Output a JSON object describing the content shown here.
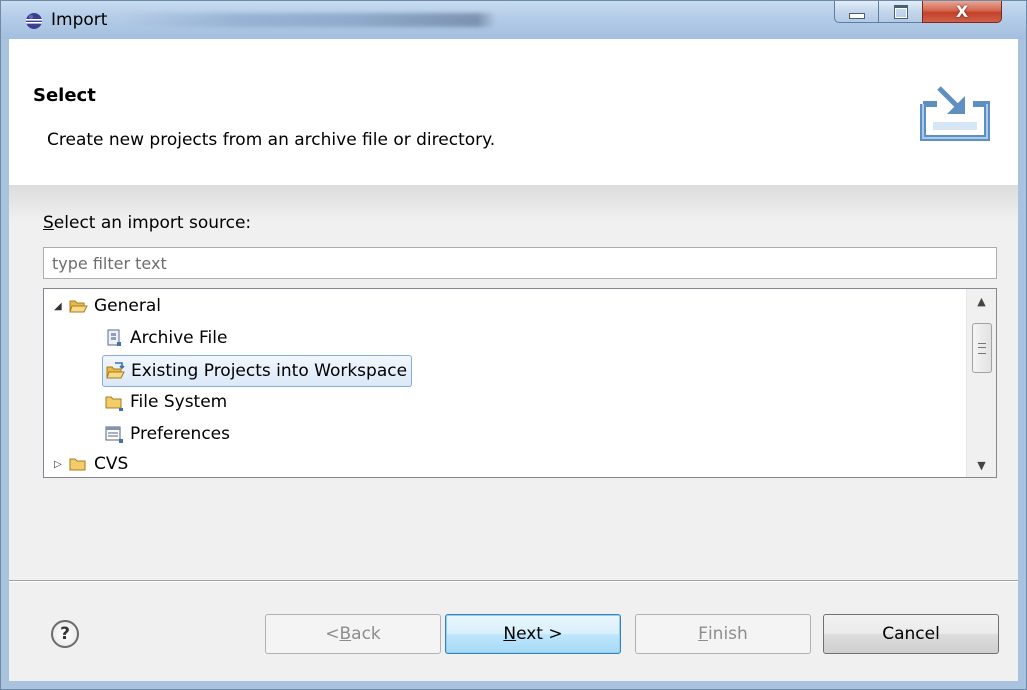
{
  "window": {
    "title": "Import",
    "minimize_label": "minimize",
    "maximize_label": "maximize",
    "close_glyph": "X"
  },
  "header": {
    "title": "Select",
    "description": "Create new projects from an archive file or directory.",
    "icon": "import-wizard-icon"
  },
  "source": {
    "label_mnemonic": "S",
    "label_rest": "elect an import source:",
    "filter_placeholder": "type filter text"
  },
  "tree": {
    "items": [
      {
        "label": "General",
        "icon": "folder-open-icon",
        "expanded": true,
        "level": 0
      },
      {
        "label": "Archive File",
        "icon": "archive-file-icon",
        "level": 1
      },
      {
        "label": "Existing Projects into Workspace",
        "icon": "existing-projects-icon",
        "level": 1,
        "selected": true
      },
      {
        "label": "File System",
        "icon": "folder-icon",
        "level": 1
      },
      {
        "label": "Preferences",
        "icon": "preferences-icon",
        "level": 1
      },
      {
        "label": "CVS",
        "icon": "folder-icon",
        "expanded": false,
        "level": 0
      }
    ]
  },
  "buttons": {
    "help": "?",
    "back_prefix": "< ",
    "back_mnemonic": "B",
    "back_rest": "ack",
    "next_mnemonic": "N",
    "next_rest": "ext >",
    "finish_mnemonic": "F",
    "finish_rest": "inish",
    "cancel": "Cancel"
  },
  "colors": {
    "selection_border": "#84acdd",
    "default_button_border": "#3c7fb1",
    "close_button": "#c4412a"
  }
}
